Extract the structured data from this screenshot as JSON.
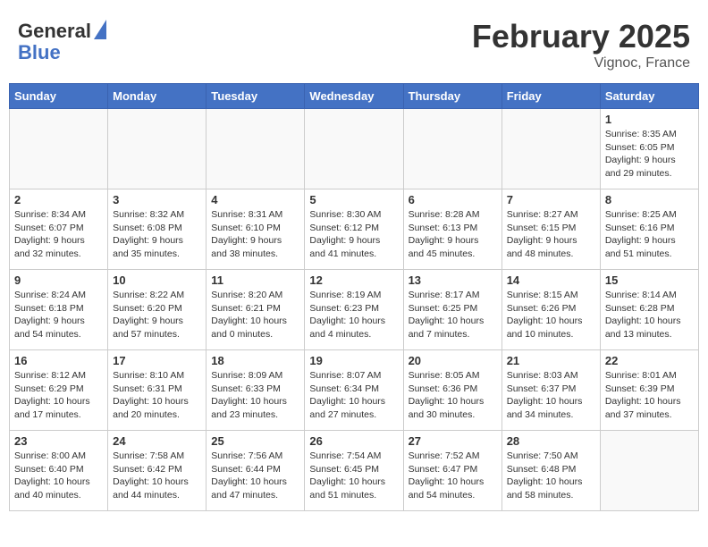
{
  "header": {
    "logo_line1": "General",
    "logo_line2": "Blue",
    "month_title": "February 2025",
    "location": "Vignoc, France"
  },
  "weekdays": [
    "Sunday",
    "Monday",
    "Tuesday",
    "Wednesday",
    "Thursday",
    "Friday",
    "Saturday"
  ],
  "weeks": [
    [
      {
        "day": "",
        "info": ""
      },
      {
        "day": "",
        "info": ""
      },
      {
        "day": "",
        "info": ""
      },
      {
        "day": "",
        "info": ""
      },
      {
        "day": "",
        "info": ""
      },
      {
        "day": "",
        "info": ""
      },
      {
        "day": "1",
        "info": "Sunrise: 8:35 AM\nSunset: 6:05 PM\nDaylight: 9 hours and 29 minutes."
      }
    ],
    [
      {
        "day": "2",
        "info": "Sunrise: 8:34 AM\nSunset: 6:07 PM\nDaylight: 9 hours and 32 minutes."
      },
      {
        "day": "3",
        "info": "Sunrise: 8:32 AM\nSunset: 6:08 PM\nDaylight: 9 hours and 35 minutes."
      },
      {
        "day": "4",
        "info": "Sunrise: 8:31 AM\nSunset: 6:10 PM\nDaylight: 9 hours and 38 minutes."
      },
      {
        "day": "5",
        "info": "Sunrise: 8:30 AM\nSunset: 6:12 PM\nDaylight: 9 hours and 41 minutes."
      },
      {
        "day": "6",
        "info": "Sunrise: 8:28 AM\nSunset: 6:13 PM\nDaylight: 9 hours and 45 minutes."
      },
      {
        "day": "7",
        "info": "Sunrise: 8:27 AM\nSunset: 6:15 PM\nDaylight: 9 hours and 48 minutes."
      },
      {
        "day": "8",
        "info": "Sunrise: 8:25 AM\nSunset: 6:16 PM\nDaylight: 9 hours and 51 minutes."
      }
    ],
    [
      {
        "day": "9",
        "info": "Sunrise: 8:24 AM\nSunset: 6:18 PM\nDaylight: 9 hours and 54 minutes."
      },
      {
        "day": "10",
        "info": "Sunrise: 8:22 AM\nSunset: 6:20 PM\nDaylight: 9 hours and 57 minutes."
      },
      {
        "day": "11",
        "info": "Sunrise: 8:20 AM\nSunset: 6:21 PM\nDaylight: 10 hours and 0 minutes."
      },
      {
        "day": "12",
        "info": "Sunrise: 8:19 AM\nSunset: 6:23 PM\nDaylight: 10 hours and 4 minutes."
      },
      {
        "day": "13",
        "info": "Sunrise: 8:17 AM\nSunset: 6:25 PM\nDaylight: 10 hours and 7 minutes."
      },
      {
        "day": "14",
        "info": "Sunrise: 8:15 AM\nSunset: 6:26 PM\nDaylight: 10 hours and 10 minutes."
      },
      {
        "day": "15",
        "info": "Sunrise: 8:14 AM\nSunset: 6:28 PM\nDaylight: 10 hours and 13 minutes."
      }
    ],
    [
      {
        "day": "16",
        "info": "Sunrise: 8:12 AM\nSunset: 6:29 PM\nDaylight: 10 hours and 17 minutes."
      },
      {
        "day": "17",
        "info": "Sunrise: 8:10 AM\nSunset: 6:31 PM\nDaylight: 10 hours and 20 minutes."
      },
      {
        "day": "18",
        "info": "Sunrise: 8:09 AM\nSunset: 6:33 PM\nDaylight: 10 hours and 23 minutes."
      },
      {
        "day": "19",
        "info": "Sunrise: 8:07 AM\nSunset: 6:34 PM\nDaylight: 10 hours and 27 minutes."
      },
      {
        "day": "20",
        "info": "Sunrise: 8:05 AM\nSunset: 6:36 PM\nDaylight: 10 hours and 30 minutes."
      },
      {
        "day": "21",
        "info": "Sunrise: 8:03 AM\nSunset: 6:37 PM\nDaylight: 10 hours and 34 minutes."
      },
      {
        "day": "22",
        "info": "Sunrise: 8:01 AM\nSunset: 6:39 PM\nDaylight: 10 hours and 37 minutes."
      }
    ],
    [
      {
        "day": "23",
        "info": "Sunrise: 8:00 AM\nSunset: 6:40 PM\nDaylight: 10 hours and 40 minutes."
      },
      {
        "day": "24",
        "info": "Sunrise: 7:58 AM\nSunset: 6:42 PM\nDaylight: 10 hours and 44 minutes."
      },
      {
        "day": "25",
        "info": "Sunrise: 7:56 AM\nSunset: 6:44 PM\nDaylight: 10 hours and 47 minutes."
      },
      {
        "day": "26",
        "info": "Sunrise: 7:54 AM\nSunset: 6:45 PM\nDaylight: 10 hours and 51 minutes."
      },
      {
        "day": "27",
        "info": "Sunrise: 7:52 AM\nSunset: 6:47 PM\nDaylight: 10 hours and 54 minutes."
      },
      {
        "day": "28",
        "info": "Sunrise: 7:50 AM\nSunset: 6:48 PM\nDaylight: 10 hours and 58 minutes."
      },
      {
        "day": "",
        "info": ""
      }
    ]
  ]
}
